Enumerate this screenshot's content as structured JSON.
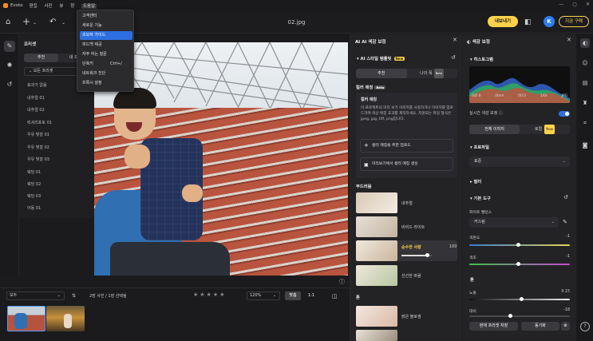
{
  "app": {
    "name": "Evoto",
    "file_title": "02.jpg",
    "menus": [
      "편집",
      "사진",
      "뷰",
      "창",
      "도움말"
    ]
  },
  "toolbar": {
    "export_label": "내보내기",
    "avatar_letter": "K",
    "buy_label": "지금 구매"
  },
  "help_menu": {
    "items": [
      {
        "label": "고객센터"
      },
      {
        "label": "새로운 기능"
      },
      {
        "label": "초보자 가이드",
        "selected": true
      },
      {
        "label": "피드백 제공"
      },
      {
        "label": "자주 하는 질문"
      },
      {
        "label": "단축키",
        "shortcut": "Ctrl+/"
      },
      {
        "label": "네트워크 진단"
      },
      {
        "label": "프록시 설정"
      }
    ]
  },
  "preset_panel": {
    "title": "프리셋",
    "tabs": [
      "추천",
      "내 프리"
    ],
    "select_value": "모든 프리셋",
    "items": [
      "효과가 없음",
      "내추럴 01",
      "내추럴 02",
      "럭셔리포토 01",
      "우유 빛깔 01",
      "우유 빛깔 02",
      "우유 빛깔 03",
      "웨딩 01",
      "웨딩 02",
      "웨딩 03",
      "아동 01"
    ]
  },
  "filmstrip": {
    "filter_value": "모두",
    "info": "2장 사진 / 1장 선택됨",
    "stars": "★★★★★",
    "zoom_value": "120%",
    "fit_label": "맞춤",
    "one_label": "1:1"
  },
  "ai_panel": {
    "title": "AI 색감 보정",
    "template_title": "AI 스타일 템플릿",
    "new_badge": "New",
    "tabs": [
      "추천",
      "나의 폭"
    ],
    "tab_badge": "Beta",
    "color_matching_label": "컬러 매칭",
    "color_matching_badge": "Beta",
    "box_title": "컬러 매칭",
    "box_desc": "이 프로젝트의 미리 보기 이미지를 사용하거나 이미지를 업로드하여 색상 매칭 효과를 제작하세요. 지원되는 파일 형식은 jpeg, jpg, tiff, png입니다.",
    "upload_label": "컬러 매칭을 위한 업로드",
    "generate_label": "미리보기에서 컬러 매칭 생성",
    "bootcamp_label": "부드러움",
    "items": [
      {
        "label": "내추럴",
        "selected": false
      },
      {
        "label": "비비드 라이트",
        "selected": false
      },
      {
        "label": "순수한 사랑",
        "selected": true,
        "value": 100,
        "level": 0.85
      },
      {
        "label": "선선한 바람",
        "selected": false
      }
    ],
    "section2_label": "톤",
    "items2": [
      {
        "label": "밝은 블로썸"
      }
    ]
  },
  "adjust_panel": {
    "title": "색감 보정",
    "histogram_label": "히스토그램",
    "histo_info": [
      "ISO 0",
      "0mm",
      "f/0.0",
      "1/0s",
      "JPG"
    ],
    "realtime_label": "실시간 색감 보정",
    "realtime_on": true,
    "tabs": [
      "전체 이미지",
      "로컬"
    ],
    "local_badge": "New",
    "profile_label": "프로파일",
    "profile_value": "표준",
    "filter_label": "필터",
    "basic_label": "기본 도구",
    "wb_label": "화이트 밸런스",
    "wb_value": "커스텀",
    "sliders": [
      {
        "label": "색온도",
        "value": "-1",
        "level": 0.49
      },
      {
        "label": "색조",
        "value": "-1",
        "level": 0.49
      }
    ],
    "tone_label": "톤",
    "tone_sliders": [
      {
        "label": "노출",
        "value": "0.15",
        "level": 0.52
      },
      {
        "label": "대비",
        "value": "-18",
        "level": 0.41
      }
    ],
    "save_preset_label": "현재 프리셋 저장",
    "sync_label": "동기화"
  },
  "colors": {
    "accent": "#2d6fe0",
    "highlight": "#ffd24a"
  }
}
